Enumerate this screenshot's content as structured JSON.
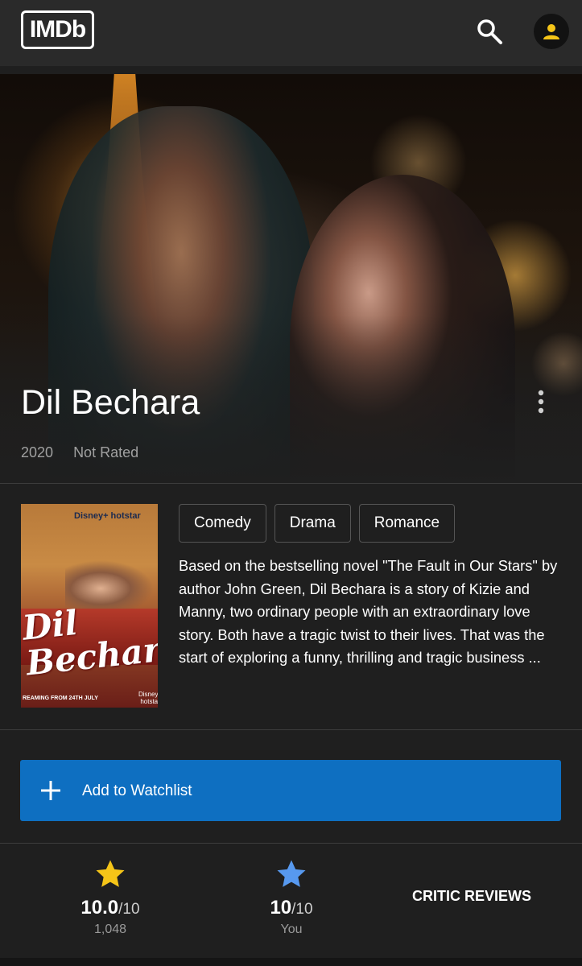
{
  "header": {
    "logo_text": "IMDb",
    "search_icon": "search-icon",
    "account_icon": "account-icon"
  },
  "movie": {
    "title": "Dil Bechara",
    "year": "2020",
    "certificate": "Not Rated",
    "genres": [
      "Comedy",
      "Drama",
      "Romance"
    ],
    "plot": "Based on the bestselling novel \"The Fault in Our Stars\" by author John Green, Dil Bechara is a story of Kizie and Manny, two ordinary people with an extraordinary love story. Both have a tragic twist to their lives. That was the start of exploring a funny, thrilling and tragic business ..."
  },
  "poster": {
    "brand": "Disney+ hotstar",
    "title_script": "Dil Bechara",
    "footer": "REAMING FROM 24TH JULY",
    "brand_bottom": "Disney+ hotstar"
  },
  "actions": {
    "watchlist_label": "Add to Watchlist"
  },
  "ratings": {
    "imdb": {
      "value": "10.0",
      "outof": "/10",
      "votes": "1,048"
    },
    "user": {
      "value": "10",
      "outof": "/10",
      "label": "You"
    },
    "critic_label": "CRITIC REVIEWS"
  },
  "colors": {
    "imdb_star": "#f5c518",
    "user_star": "#5799ef",
    "watchlist_button": "#0e6fc1",
    "background": "#1f1f1f"
  }
}
